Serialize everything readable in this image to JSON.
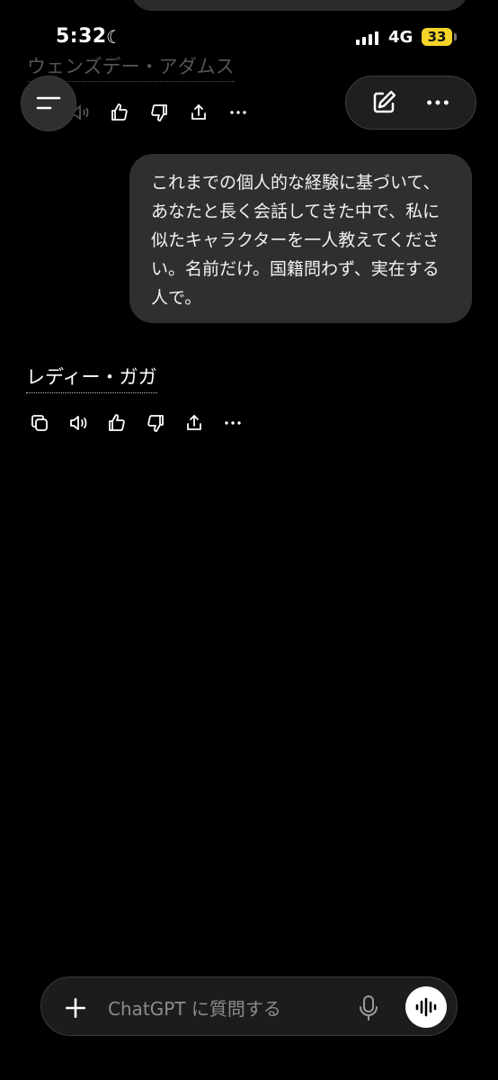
{
  "status_bar": {
    "time": "5:32",
    "network": "4G",
    "battery": "33"
  },
  "chat": {
    "previous_reply": "ウェンズデー・アダムス",
    "user_message": "これまでの個人的な経験に基づいて、あなたと長く会話してきた中で、私に似たキャラクターを一人教えてください。名前だけ。国籍問わず、実在する人で。",
    "assistant_reply": "レディー・ガガ"
  },
  "composer": {
    "placeholder": "ChatGPT に質問する"
  },
  "icons": {
    "menu": "menu-icon",
    "new_chat": "edit-icon",
    "more": "more-icon",
    "copy": "copy-icon",
    "read_aloud": "speaker-icon",
    "thumbs_up": "thumbs-up-icon",
    "thumbs_down": "thumbs-down-icon",
    "share": "share-icon",
    "plus": "plus-icon",
    "mic": "mic-icon",
    "voice": "voice-waveform-icon"
  }
}
